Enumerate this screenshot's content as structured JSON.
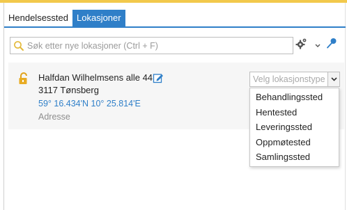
{
  "tabs": [
    {
      "label": "Hendelsessted",
      "active": false
    },
    {
      "label": "Lokasjoner",
      "active": true
    }
  ],
  "search": {
    "placeholder": "Søk etter nye lokasjoner (Ctrl + F)",
    "value": ""
  },
  "toolbar": {
    "settings_icon": "gear-icon",
    "pin_icon": "pushpin-icon"
  },
  "location": {
    "street": "Halfdan Wilhelmsens alle 44",
    "postal": "3117 Tønsberg",
    "coordinates": "59° 16.434'N 10° 25.814'E",
    "type_label": "Adresse",
    "lock_icon": "unlocked-padlock-icon"
  },
  "location_type_select": {
    "placeholder": "Velg lokasjonstype",
    "options": [
      "Behandlingssted",
      "Hentested",
      "Leveringssted",
      "Oppmøtested",
      "Samlingssted"
    ]
  },
  "colors": {
    "accent_top": "#f2c94c",
    "tab_active": "#2f7fc8",
    "link": "#2f7fc8"
  }
}
